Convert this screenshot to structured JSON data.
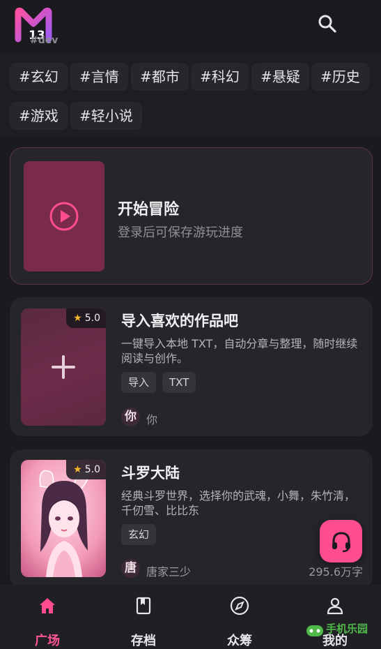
{
  "header": {
    "logo_sub": "#dev",
    "search_icon": "search-icon"
  },
  "tags": [
    "#玄幻",
    "#言情",
    "#都市",
    "#科幻",
    "#悬疑",
    "#历史",
    "#游戏",
    "#轻小说"
  ],
  "start_card": {
    "title": "开始冒险",
    "subtitle": "登录后可保存游玩进度",
    "icon": "play-circle-icon"
  },
  "books": [
    {
      "title": "导入喜欢的作品吧",
      "description": "一键导入本地 TXT，自动分章与整理，随时继续阅读与创作。",
      "rating": "5.0",
      "tags": [
        "导入",
        "TXT"
      ],
      "avatar": "你",
      "author": "你",
      "word_count": "",
      "cover_icon": "plus-icon"
    },
    {
      "title": "斗罗大陆",
      "description": "经典斗罗世界，选择你的武魂，小舞，朱竹清，千仞雪、比比东",
      "rating": "5.0",
      "tags": [
        "玄幻"
      ],
      "avatar": "唐",
      "author": "唐家三少",
      "word_count": "295.6万字",
      "cover_icon": "anime-portrait-image"
    }
  ],
  "fab_icon": "headset-icon",
  "nav": [
    {
      "label": "广场",
      "icon": "home-icon",
      "active": true
    },
    {
      "label": "存档",
      "icon": "bookmark-icon",
      "active": false
    },
    {
      "label": "众筹",
      "icon": "compass-icon",
      "active": false
    },
    {
      "label": "我的",
      "icon": "user-icon",
      "active": false
    }
  ],
  "watermark": "手机乐园",
  "colors": {
    "accent": "#ff4d8e",
    "background": "#1b1b1f",
    "card": "#25252a",
    "cover": "#7a2a4b",
    "star": "#f6b82b"
  }
}
